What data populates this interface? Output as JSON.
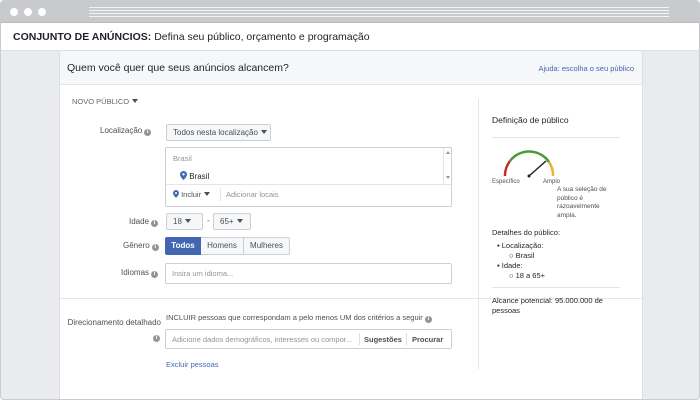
{
  "header": {
    "title": "CONJUNTO DE ANÚNCIOS:",
    "subtitle": "Defina seu público, orçamento e programação"
  },
  "panel": {
    "title": "Quem você quer que seus anúncios alcancem?",
    "help_link": "Ajuda: escolha o seu público"
  },
  "audience_dropdown": "NOVO PÚBLICO",
  "location": {
    "label": "Localização",
    "scope_dropdown": "Todos nesta localização",
    "country_group": "Brasil",
    "selected": "Brasil",
    "include_dropdown": "Incluir",
    "placeholder": "Adicionar locais"
  },
  "age": {
    "label": "Idade",
    "min": "18",
    "separator": "-",
    "max": "65+"
  },
  "gender": {
    "label": "Gênero",
    "options": [
      "Todos",
      "Homens",
      "Mulheres"
    ],
    "selected": "Todos"
  },
  "languages": {
    "label": "Idiomas",
    "placeholder": "Insira um idioma..."
  },
  "detailed_targeting": {
    "label": "Direcionamento detalhado",
    "instruction": "INCLUIR pessoas que correspondam a pelo menos UM dos critérios a seguir",
    "placeholder": "Adicione dados demográficos, interesses ou compor...",
    "suggestions_button": "Sugestões",
    "browse_button": "Procurar",
    "exclude_link": "Excluir pessoas"
  },
  "audience_definition": {
    "title": "Definição de público",
    "gauge_left": "Específico",
    "gauge_right": "Amplo",
    "gauge_level": 0.78,
    "gauge_note_lines": [
      "A sua seleção de",
      "público é",
      "razoavelmente",
      "ampla."
    ],
    "details_title": "Detalhes do público:",
    "location_item": "Localização:",
    "location_value": "Brasil",
    "age_item": "Idade:",
    "age_value": "18 a 65+",
    "reach": "Alcance potencial: 95.000.000 de pessoas"
  },
  "colors": {
    "brand": "#4267b2",
    "gauge_red": "#c72c2c",
    "gauge_green": "#4a9b3c",
    "gauge_yellow": "#e8b23a"
  }
}
